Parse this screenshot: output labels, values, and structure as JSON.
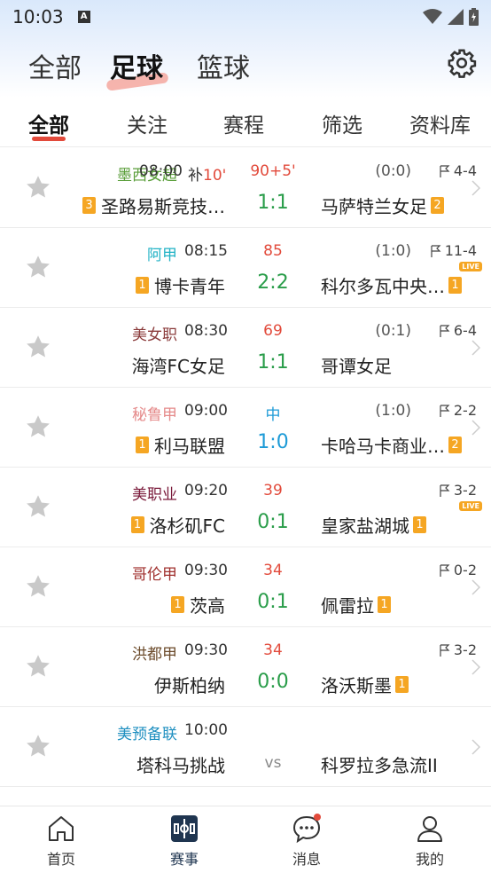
{
  "status_bar": {
    "time": "10:03",
    "notification": "A"
  },
  "sport_tabs": [
    {
      "label": "全部",
      "active": false
    },
    {
      "label": "足球",
      "active": true
    },
    {
      "label": "篮球",
      "active": false
    }
  ],
  "sub_tabs": [
    {
      "label": "全部",
      "active": true
    },
    {
      "label": "关注",
      "active": false
    },
    {
      "label": "赛程",
      "active": false
    },
    {
      "label": "筛选",
      "active": false
    },
    {
      "label": "资料库",
      "active": false
    }
  ],
  "colors": {
    "accent_red": "#e24a3b",
    "score_green": "#2a9d4a",
    "halftime_blue": "#1e9bd7",
    "badge_orange": "#f5a623"
  },
  "matches": [
    {
      "league": "墨西女超",
      "league_color": "#5a9e3a",
      "time": "08:00",
      "extra_prefix": "补",
      "extra_value": "10'",
      "minute": "90+5'",
      "halftime": "(0:0)",
      "corners": "4-4",
      "home": "圣路易斯竞技…",
      "home_badge": "3",
      "score": "1:1",
      "away": "马萨特兰女足",
      "away_badge": "2",
      "live": ""
    },
    {
      "league": "阿甲",
      "league_color": "#23b3c6",
      "time": "08:15",
      "minute": "85",
      "halftime": "(1:0)",
      "corners": "11-4",
      "home": "博卡青年",
      "home_badge": "1",
      "score": "2:2",
      "away": "科尔多瓦中央…",
      "away_badge": "1",
      "live": "LIVE"
    },
    {
      "league": "美女职",
      "league_color": "#8a3a3a",
      "time": "08:30",
      "minute": "69",
      "halftime": "(0:1)",
      "corners": "6-4",
      "home": "海湾FC女足",
      "home_badge": "",
      "score": "1:1",
      "away": "哥谭女足",
      "away_badge": "",
      "live": ""
    },
    {
      "league": "秘鲁甲",
      "league_color": "#e58a8a",
      "time": "09:00",
      "minute": "中",
      "halftime": "(1:0)",
      "corners": "2-2",
      "home": "利马联盟",
      "home_badge": "1",
      "score": "1:0",
      "away": "卡哈马卡商业…",
      "away_badge": "2",
      "live": ""
    },
    {
      "league": "美职业",
      "league_color": "#7a1a3a",
      "time": "09:20",
      "minute": "39",
      "halftime": "",
      "corners": "3-2",
      "home": "洛杉矶FC",
      "home_badge": "1",
      "score": "0:1",
      "away": "皇家盐湖城",
      "away_badge": "1",
      "live": "LIVE"
    },
    {
      "league": "哥伦甲",
      "league_color": "#a0302e",
      "time": "09:30",
      "minute": "34",
      "halftime": "",
      "corners": "0-2",
      "home": "茨高",
      "home_badge": "1",
      "score": "0:1",
      "away": "佩雷拉",
      "away_badge": "1",
      "live": ""
    },
    {
      "league": "洪都甲",
      "league_color": "#6b4a2a",
      "time": "09:30",
      "minute": "34",
      "halftime": "",
      "corners": "3-2",
      "home": "伊斯柏纳",
      "home_badge": "",
      "score": "0:0",
      "away": "洛沃斯墨",
      "away_badge": "1",
      "live": ""
    },
    {
      "league": "美预备联",
      "league_color": "#1e8fc0",
      "time": "10:00",
      "minute": "",
      "halftime": "",
      "corners": "",
      "home": "塔科马挑战",
      "home_badge": "",
      "score": "vs",
      "away": "科罗拉多急流II",
      "away_badge": "",
      "live": ""
    }
  ],
  "bottom_nav": [
    {
      "label": "首页",
      "icon": "home-icon",
      "active": false
    },
    {
      "label": "赛事",
      "icon": "match-icon",
      "active": true
    },
    {
      "label": "消息",
      "icon": "message-icon",
      "active": false
    },
    {
      "label": "我的",
      "icon": "user-icon",
      "active": false
    }
  ]
}
